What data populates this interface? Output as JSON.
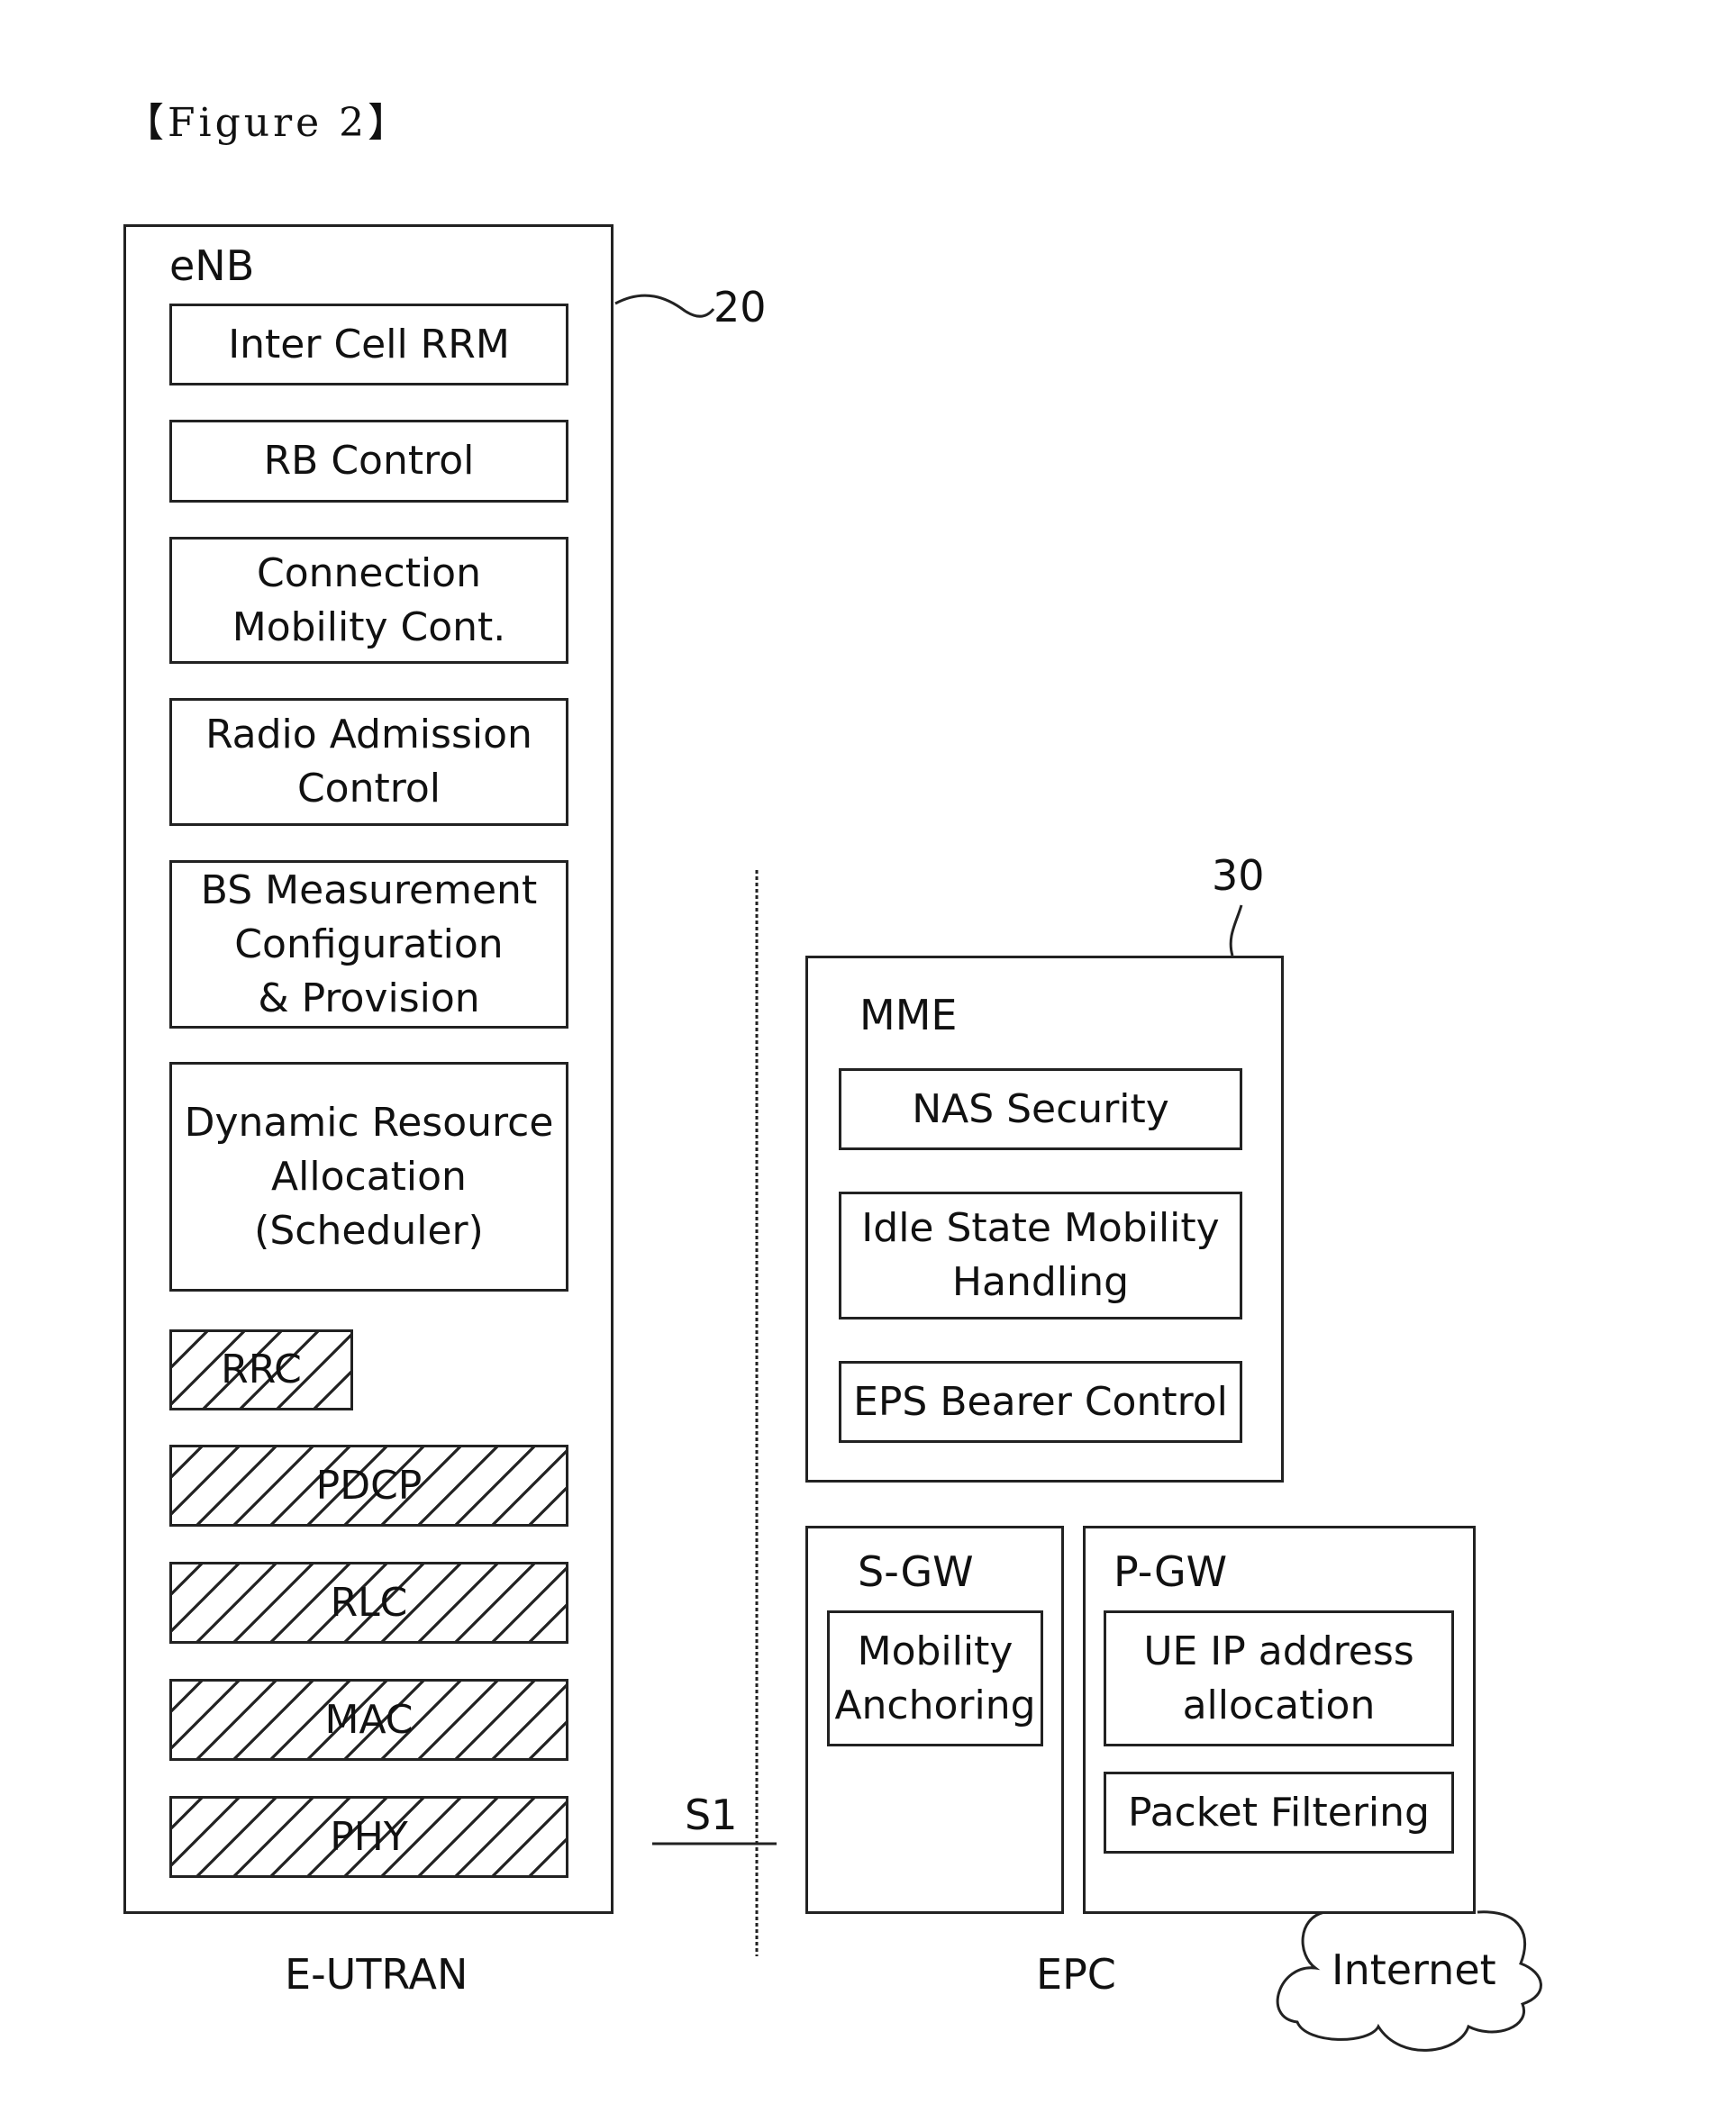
{
  "figure_label": "【Figure 2】",
  "enb": {
    "title": "eNB",
    "ref": "20",
    "functions": [
      "Inter Cell RRM",
      "RB Control",
      "Connection\nMobility Cont.",
      "Radio Admission\nControl",
      "BS Measurement\nConfiguration\n& Provision",
      "Dynamic Resource\nAllocation\n(Scheduler)"
    ],
    "protocol_layers": [
      "RRC",
      "PDCP",
      "RLC",
      "MAC",
      "PHY"
    ]
  },
  "interface": {
    "label": "S1"
  },
  "mme": {
    "title": "MME",
    "ref": "30",
    "functions": [
      "NAS Security",
      "Idle State Mobility\nHandling",
      "EPS Bearer Control"
    ]
  },
  "sgw": {
    "title": "S-GW",
    "functions": [
      "Mobility\nAnchoring"
    ]
  },
  "pgw": {
    "title": "P-GW",
    "functions": [
      "UE IP address\nallocation",
      "Packet Filtering"
    ]
  },
  "network": {
    "label": "Internet"
  },
  "sections": {
    "left": "E-UTRAN",
    "right": "EPC"
  }
}
